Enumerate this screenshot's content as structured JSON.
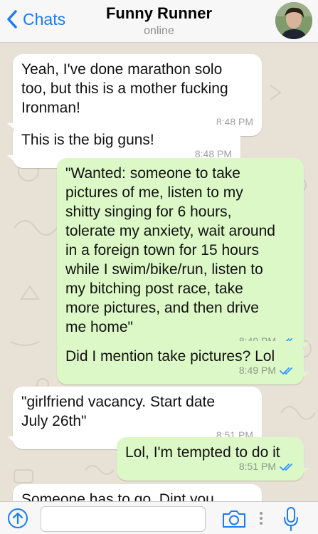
{
  "header": {
    "back_label": "Chats",
    "contact_name": "Funny Runner",
    "status": "online"
  },
  "messages": [
    {
      "direction": "incoming",
      "text": "Yeah, I've done marathon solo\ntoo, but this is a mother fucking\nIronman!",
      "time": "8:48 PM"
    },
    {
      "direction": "incoming",
      "text": "This is the big guns!",
      "time": "8:48 PM"
    },
    {
      "direction": "outgoing",
      "text": "\"Wanted: someone to take\npictures of me, listen to my\nshitty singing for 6 hours,\ntolerate my anxiety, wait around\nin a foreign town for 15 hours\nwhile I swim/bike/run, listen to\nmy bitching post race, take\nmore pictures, and then drive\nme home\"",
      "time": "8:49 PM",
      "read": true
    },
    {
      "direction": "outgoing",
      "text": "Did I mention take pictures? Lol",
      "time": "8:49 PM",
      "read": true
    },
    {
      "direction": "incoming",
      "text": "\"girlfriend vacancy. Start date\nJuly 26th\"",
      "time": "8:51 PM"
    },
    {
      "direction": "outgoing",
      "text": "Lol, I'm tempted to do it",
      "time": "8:51 PM",
      "read": true
    },
    {
      "direction": "incoming",
      "text": "Someone has to go. Dint you",
      "time": ""
    }
  ],
  "composer": {
    "input_value": "",
    "icons": [
      "share-arrow-icon",
      "camera-icon",
      "microphone-icon"
    ]
  },
  "colors": {
    "accent": "#1b7bf6",
    "outgoing_bubble": "#dcf8c6",
    "incoming_bubble": "#ffffff",
    "chat_background": "#e7e1d6",
    "read_ticks": "#3497f9"
  }
}
